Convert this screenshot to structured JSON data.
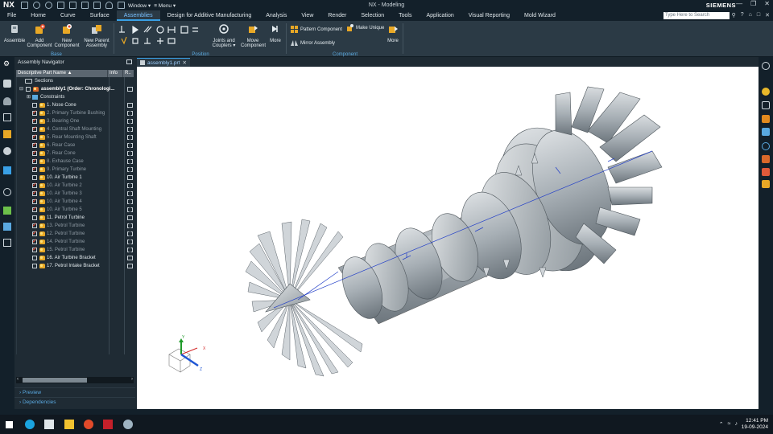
{
  "titlebar": {
    "logo": "NX",
    "window_menu": "Window ▾",
    "menu_menu": "≡ Menu ▾",
    "title": "NX - Modeling",
    "brand": "SIEMENS"
  },
  "tabs": [
    "File",
    "Home",
    "Curve",
    "Surface",
    "Assemblies",
    "Design for Additive Manufacturing",
    "Analysis",
    "View",
    "Render",
    "Selection",
    "Tools",
    "Application",
    "Visual Reporting",
    "Mold Wizard"
  ],
  "active_tab": "Assemblies",
  "search": {
    "placeholder": "Type Here to Search"
  },
  "ribbon": {
    "base_buttons": [
      {
        "label": "Assemble"
      },
      {
        "label": "Add\nComponent"
      },
      {
        "label": "New\nComponent"
      },
      {
        "label": "New Parent\nAssembly"
      }
    ],
    "base_group": "Base",
    "position_group": "Position",
    "joints_label": "Joints and\nCouplers ▾",
    "move_label": "Move\nComponent",
    "more1": "More",
    "pattern_label": "Pattern Component",
    "mirror_label": "Mirror Assembly",
    "make_unique_label": "Make Unique",
    "more2": "More",
    "component_group": "Component"
  },
  "navigator": {
    "title": "Assembly Navigator",
    "columns": [
      "Descriptive Part Name ▲",
      "Info",
      "R.."
    ],
    "rows": [
      {
        "label": "Sections",
        "kind": "folder",
        "indent": 8,
        "style": "normal"
      },
      {
        "label": "assembly1 (Order: Chronologi...",
        "kind": "root",
        "indent": 3,
        "style": "bold"
      },
      {
        "label": "Constraints",
        "kind": "constraints",
        "indent": 13,
        "style": "normal"
      },
      {
        "label": "1. Nose Cone",
        "kind": "comp",
        "checked": false,
        "style": "normal"
      },
      {
        "label": "2. Primary Turbine Bushing",
        "kind": "comp",
        "checked": true,
        "style": "dim"
      },
      {
        "label": "3. Bearing One",
        "kind": "comp",
        "checked": true,
        "style": "dim"
      },
      {
        "label": "4. Central Shaft Mounting",
        "kind": "comp",
        "checked": true,
        "style": "dim"
      },
      {
        "label": "5. Rear Mounting Shaft",
        "kind": "comp",
        "checked": true,
        "style": "dim"
      },
      {
        "label": "6. Rear Case",
        "kind": "comp",
        "checked": true,
        "style": "dim"
      },
      {
        "label": "7. Rear Cone",
        "kind": "comp",
        "checked": true,
        "style": "dim"
      },
      {
        "label": "8. Exhause Case",
        "kind": "comp",
        "checked": true,
        "style": "dim"
      },
      {
        "label": "9. Primary Turbine",
        "kind": "comp",
        "checked": true,
        "style": "dim"
      },
      {
        "label": "10. Air Turbine 1",
        "kind": "comp",
        "checked": false,
        "style": "normal"
      },
      {
        "label": "10. Air Turbine 2",
        "kind": "comp",
        "checked": true,
        "style": "dim"
      },
      {
        "label": "10. Air Turbine 3",
        "kind": "comp",
        "checked": true,
        "style": "dim"
      },
      {
        "label": "10. Air Turbine 4",
        "kind": "comp",
        "checked": true,
        "style": "dim"
      },
      {
        "label": "10. Air Turbine 5",
        "kind": "comp",
        "checked": true,
        "style": "dim"
      },
      {
        "label": "11. Petrol Turbine",
        "kind": "comp",
        "checked": false,
        "style": "normal"
      },
      {
        "label": "13. Petrol Turbine",
        "kind": "comp",
        "checked": true,
        "style": "dim"
      },
      {
        "label": "12. Petrol Turbine",
        "kind": "comp",
        "checked": true,
        "style": "dim"
      },
      {
        "label": "14. Petrol Turbine",
        "kind": "comp",
        "checked": true,
        "style": "dim"
      },
      {
        "label": "15. Petrol Turbine",
        "kind": "comp",
        "checked": true,
        "style": "dim"
      },
      {
        "label": "16. Air Turbine Bracket",
        "kind": "comp",
        "checked": false,
        "style": "normal"
      },
      {
        "label": "17. Petrol Intake Bracket",
        "kind": "comp",
        "checked": false,
        "style": "normal"
      }
    ],
    "preview": "Preview",
    "dependencies": "Dependencies"
  },
  "document_tab": {
    "label": "assembly1.prt"
  },
  "triad": {
    "x": "X",
    "y": "Y",
    "z": "Z"
  },
  "clock": {
    "time": "12:41 PM",
    "date": "19-09-2024"
  },
  "colors": {
    "accent": "#39a0e6",
    "ribbon": "#2b3a45",
    "dark": "#13202a",
    "viewport": "#ffffff"
  }
}
